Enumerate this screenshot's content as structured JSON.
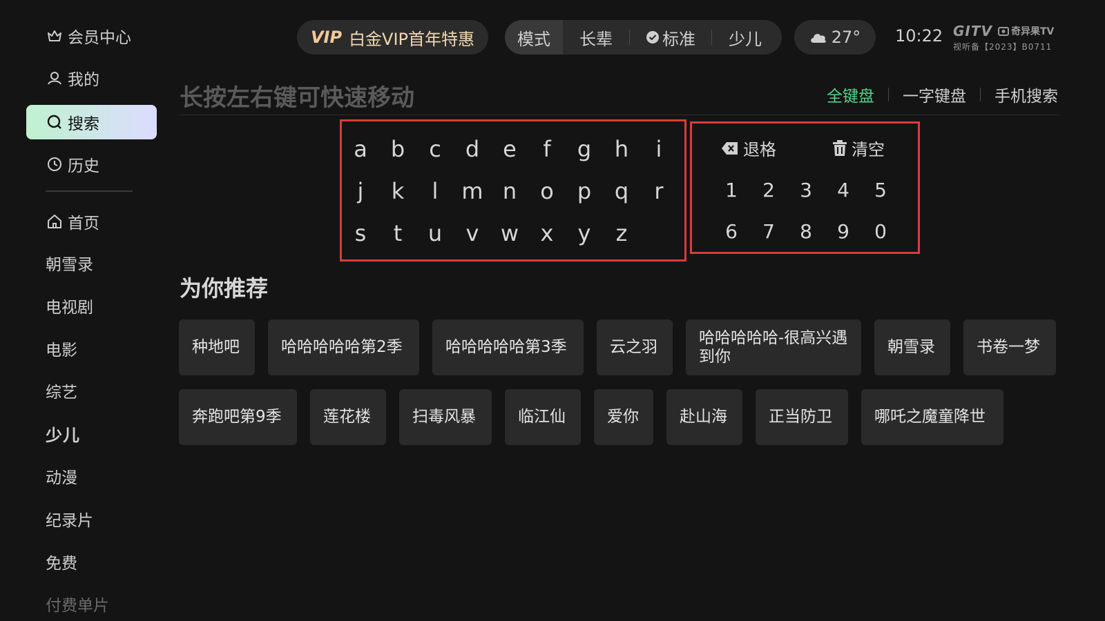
{
  "sidebar": {
    "vip_center": "会员中心",
    "mine": "我的",
    "search": "搜索",
    "history": "历史",
    "home": "首页",
    "cats": [
      "朝雪录",
      "电视剧",
      "电影",
      "综艺",
      "少儿",
      "动漫",
      "纪录片",
      "免费",
      "付费单片"
    ]
  },
  "topbar": {
    "vip_tag": "VIP",
    "vip_text": "白金VIP首年特惠",
    "modes": [
      "模式",
      "长辈",
      "标准",
      "少儿"
    ],
    "temperature": "27°",
    "time": "10:22",
    "logo_line1": "GITV",
    "logo_brand": "奇异果TV",
    "logo_line2": "视听备【2023】B0711"
  },
  "search": {
    "hint": "长按左右键可快速移动",
    "tabs": [
      "全键盘",
      "一字键盘",
      "手机搜索"
    ]
  },
  "keyboard": {
    "letters": [
      "a",
      "b",
      "c",
      "d",
      "e",
      "f",
      "g",
      "h",
      "i",
      "j",
      "k",
      "l",
      "m",
      "n",
      "o",
      "p",
      "q",
      "r",
      "s",
      "t",
      "u",
      "v",
      "w",
      "x",
      "y",
      "z"
    ],
    "backspace": "退格",
    "clear": "清空",
    "digits": [
      "1",
      "2",
      "3",
      "4",
      "5",
      "6",
      "7",
      "8",
      "9",
      "0"
    ]
  },
  "recommend": {
    "title": "为你推荐",
    "row1": [
      "种地吧",
      "哈哈哈哈哈第2季",
      "哈哈哈哈哈第3季",
      "云之羽",
      "哈哈哈哈哈-很高兴遇到你",
      "朝雪录",
      "书卷一梦"
    ],
    "row2": [
      "奔跑吧第9季",
      "莲花楼",
      "扫毒风暴",
      "临江仙",
      "爱你",
      "赴山海",
      "正当防卫",
      "哪吒之魔童降世"
    ]
  },
  "colors": {
    "accent_green": "#4fd48a",
    "highlight_red": "#d93c3c",
    "vip_gold": "#f3d7b0"
  }
}
